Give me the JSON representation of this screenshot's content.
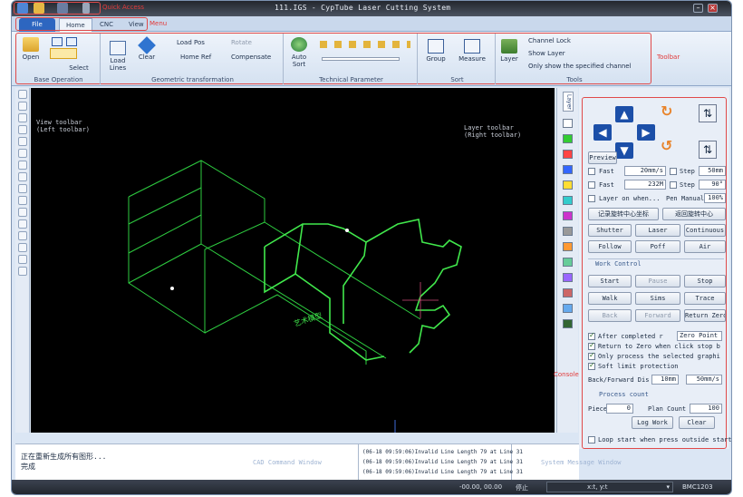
{
  "window": {
    "title": "111.IGS - CypTube Laser Cutting System"
  },
  "quick_access": {
    "label": "Quick Access"
  },
  "menu": {
    "tabs": [
      "File",
      "Home",
      "CNC",
      "View"
    ],
    "label": "Menu"
  },
  "ribbon": {
    "label": "Toolbar",
    "base_operation": {
      "label": "Base Operation",
      "open": "Open",
      "select": "Select"
    },
    "geometric_transformation": {
      "label": "Geometric transformation",
      "load_lines": "Load Lines",
      "clear": "Clear",
      "load_pos": "Load Pos",
      "rotate": "Rotate",
      "home_ref": "Home Ref",
      "compensate": "Compensate"
    },
    "technical_parameter": {
      "label": "Technical Parameter",
      "auto_sort": "Auto Sort"
    },
    "sort": {
      "label": "Sort",
      "group": "Group",
      "measure": "Measure"
    },
    "tools": {
      "label": "Tools",
      "layer": "Layer",
      "channel_lock": "Channel Lock",
      "show_layer": "Show Layer",
      "only_show": "Only show the specified channel"
    }
  },
  "canvas": {
    "view_toolbar_label": "View toolbar\n(Left toolbar)",
    "layer_toolbar_label": "Layer toolbar\n(Right toolbar)",
    "part_text": "艺术模型"
  },
  "layers": {
    "tab_label": "Layer",
    "colors": [
      "#ffffff",
      "#33cc33",
      "#ff4444",
      "#3366ff",
      "#ffdd33",
      "#33cccc",
      "#cc33cc",
      "#999999",
      "#ff9933",
      "#66cc99",
      "#9966ff",
      "#cc6666",
      "#66aaee",
      "#336633"
    ]
  },
  "panel": {
    "preview": "Preview",
    "fast1": {
      "label": "Fast",
      "value": "20mm/s"
    },
    "step1": {
      "label": "Step",
      "value": "50mm"
    },
    "fast2": {
      "label": "Fast",
      "value": "232M"
    },
    "step2": {
      "label": "Step",
      "value": "90°"
    },
    "layer_on_when": "Layer on when...",
    "pen_manual": "Pen Manual",
    "pen_value": "100%",
    "record_center": "记录旋转中心坐标",
    "return_center": "返回旋转中心",
    "shutter": "Shutter",
    "laser": "Laser",
    "continuous": "Continuous",
    "follow": "Follow",
    "poff": "Poff",
    "air": "Air",
    "work_control": "Work Control",
    "start": "Start",
    "pause": "Pause",
    "stop": "Stop",
    "walk": "Walk",
    "sims": "Sims",
    "trace": "Trace",
    "back": "Back",
    "forward": "Forward",
    "return_zero": "Return Zero",
    "after_completed": "After completed r",
    "zero_point": "Zero Point",
    "return_to_zero": "Return to Zero when click stop b",
    "only_process": "Only process the selected graphi",
    "soft_limit": "Soft limit protection",
    "back_forward_dis": "Back/Forward Dis",
    "dis_value": "10mm",
    "speed_value": "50mm/s",
    "process_count": "Process count",
    "piece_label": "Piece",
    "piece_value": "0",
    "plan_count_label": "Plan Count",
    "plan_count_value": "100",
    "log_work": "Log Work",
    "clear": "Clear",
    "loop_start": "Loop start when press outside start i",
    "console_label": "Console"
  },
  "bottom": {
    "log_lines": [
      "正在重新生成所有图形...",
      "完成"
    ],
    "cad_command_label": "CAD Command Window",
    "messages": [
      "(06-18 09:59:06)Invalid Line Length 79 at Line 31",
      "(06-18 09:59:06)Invalid Line Length 79 at Line 31",
      "(06-18 09:59:06)Invalid Line Length 79 at Line 31"
    ],
    "system_message_label": "System Message Window"
  },
  "statusbar": {
    "coords": "-00.00, 00.00",
    "state": "停止",
    "coord_mode": "x:t, y:t",
    "card": "BMC1203"
  }
}
